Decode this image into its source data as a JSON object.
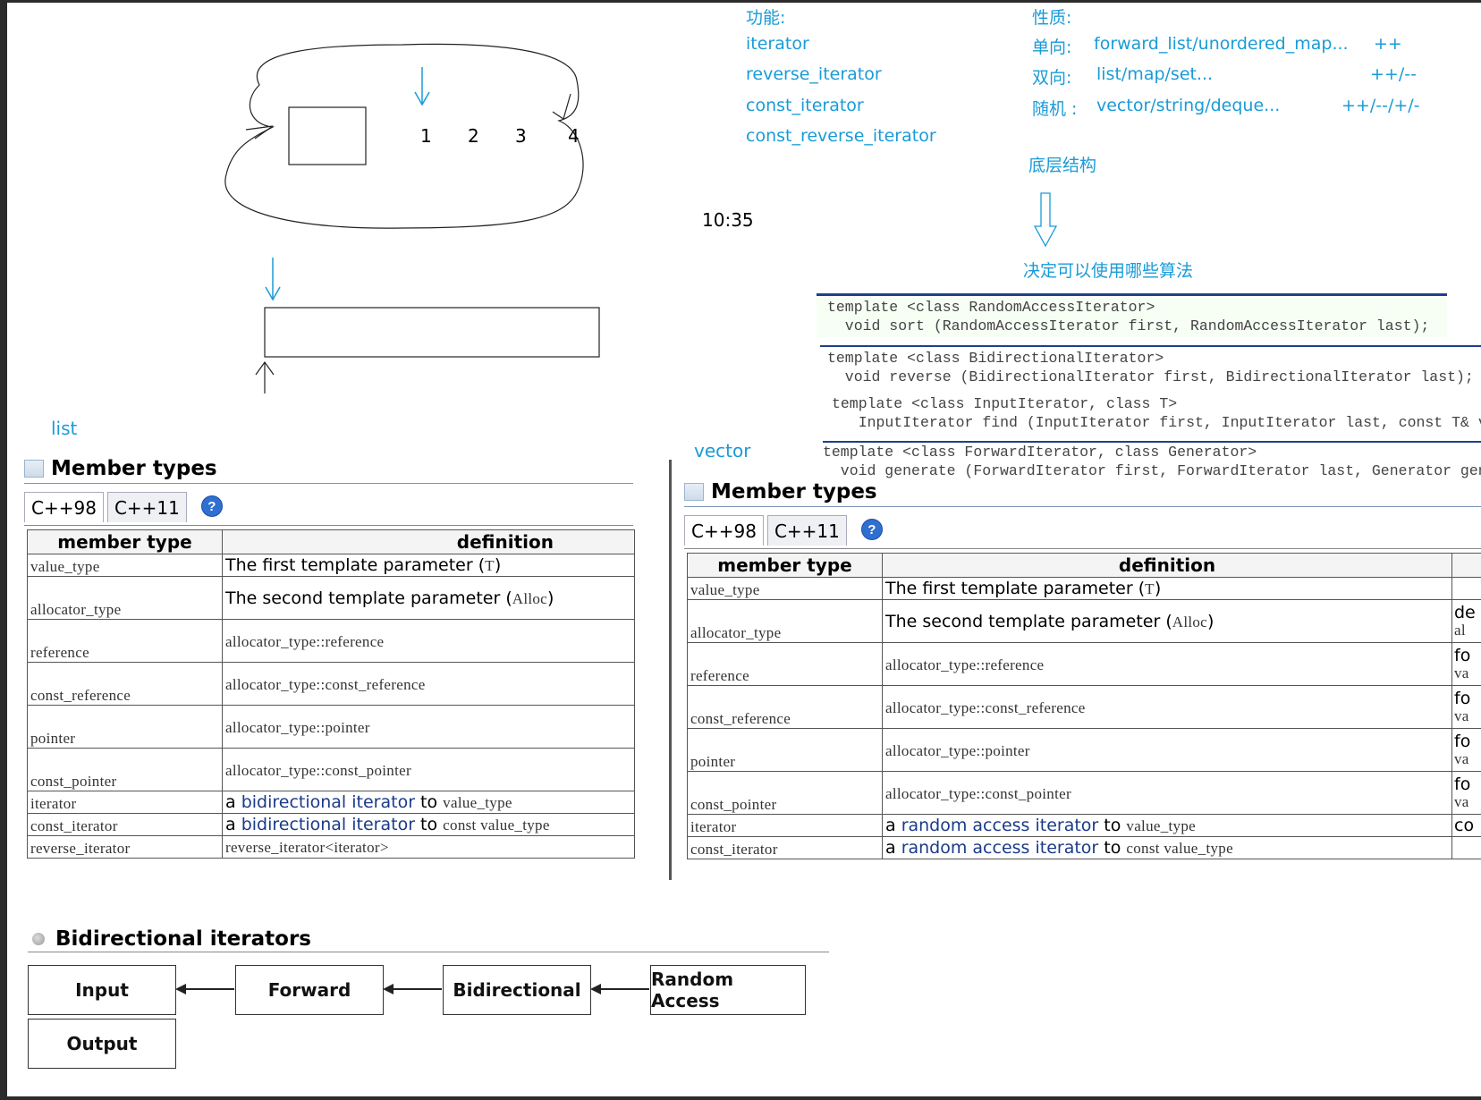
{
  "notes": {
    "list_label": "list",
    "vector_label": "vector",
    "time": "10:35",
    "function_header": "功能:",
    "iterator_kinds": [
      "iterator",
      "reverse_iterator",
      "const_iterator",
      "const_reverse_iterator"
    ],
    "property_header": "性质:",
    "properties": [
      {
        "kind": "单向:",
        "containers": "forward_list/unordered_map...",
        "ops": "++"
      },
      {
        "kind": "双向:",
        "containers": "list/map/set...",
        "ops": "++/--"
      },
      {
        "kind": "随机 :",
        "containers": "vector/string/deque...",
        "ops": "++/--/+/-"
      }
    ],
    "underlying": "底层结构",
    "decides": "决定可以使用哪些算法",
    "sketch_digits": [
      "1",
      "2",
      "3",
      "4"
    ]
  },
  "code_snippets": [
    "template <class RandomAccessIterator>\n  void sort (RandomAccessIterator first, RandomAccessIterator last);",
    "template <class BidirectionalIterator>\n  void reverse (BidirectionalIterator first, BidirectionalIterator last);",
    "template <class InputIterator, class T>\n   InputIterator find (InputIterator first, InputIterator last, const T& val);",
    "template <class ForwardIterator, class Generator>\n  void generate (ForwardIterator first, ForwardIterator last, Generator gen);"
  ],
  "list_panel": {
    "title": "Member types",
    "tabs": [
      "C++98",
      "C++11"
    ],
    "help": "?",
    "headers": [
      "member type",
      "definition"
    ],
    "rows": [
      {
        "type": "value_type",
        "def_text": "The first template parameter (",
        "def_code": "T",
        "def_end": ")"
      },
      {
        "type": "allocator_type",
        "def_text": "The second template parameter (",
        "def_code": "Alloc",
        "def_end": ")"
      },
      {
        "type": "reference",
        "def_code_only": "allocator_type::reference"
      },
      {
        "type": "const_reference",
        "def_code_only": "allocator_type::const_reference"
      },
      {
        "type": "pointer",
        "def_code_only": "allocator_type::pointer"
      },
      {
        "type": "const_pointer",
        "def_code_only": "allocator_type::const_pointer"
      },
      {
        "type": "iterator",
        "def_prefix": "a ",
        "def_link": "bidirectional iterator",
        "def_mid": " to ",
        "def_code": "value_type"
      },
      {
        "type": "const_iterator",
        "def_prefix": "a ",
        "def_link": "bidirectional iterator",
        "def_mid": " to ",
        "def_code": "const value_type"
      },
      {
        "type": "reverse_iterator",
        "def_code_only": "reverse_iterator<iterator>"
      }
    ]
  },
  "vector_panel": {
    "title": "Member types",
    "tabs": [
      "C++98",
      "C++11"
    ],
    "help": "?",
    "headers": [
      "member type",
      "definition"
    ],
    "notes_col": [
      "de",
      "al",
      "fo",
      "va",
      "fo",
      "va",
      "fo",
      "va",
      "fo",
      "va",
      "co"
    ],
    "rows": [
      {
        "type": "value_type",
        "def_text": "The first template parameter (",
        "def_code": "T",
        "def_end": ")"
      },
      {
        "type": "allocator_type",
        "def_text": "The second template parameter (",
        "def_code": "Alloc",
        "def_end": ")"
      },
      {
        "type": "reference",
        "def_code_only": "allocator_type::reference"
      },
      {
        "type": "const_reference",
        "def_code_only": "allocator_type::const_reference"
      },
      {
        "type": "pointer",
        "def_code_only": "allocator_type::pointer"
      },
      {
        "type": "const_pointer",
        "def_code_only": "allocator_type::const_pointer"
      },
      {
        "type": "iterator",
        "def_prefix": "a ",
        "def_link": "random access iterator",
        "def_mid": " to ",
        "def_code": "value_type"
      },
      {
        "type": "const_iterator",
        "def_prefix": "a ",
        "def_link": "random access iterator",
        "def_mid": " to ",
        "def_code": "const value_type"
      }
    ]
  },
  "bidir_section": {
    "title": "Bidirectional iterators",
    "boxes": [
      "Input",
      "Forward",
      "Bidirectional",
      "Random Access",
      "Output"
    ]
  },
  "colors": {
    "annotation": "#1a9bd7",
    "link": "#1a3a8a",
    "code": "#444444"
  }
}
